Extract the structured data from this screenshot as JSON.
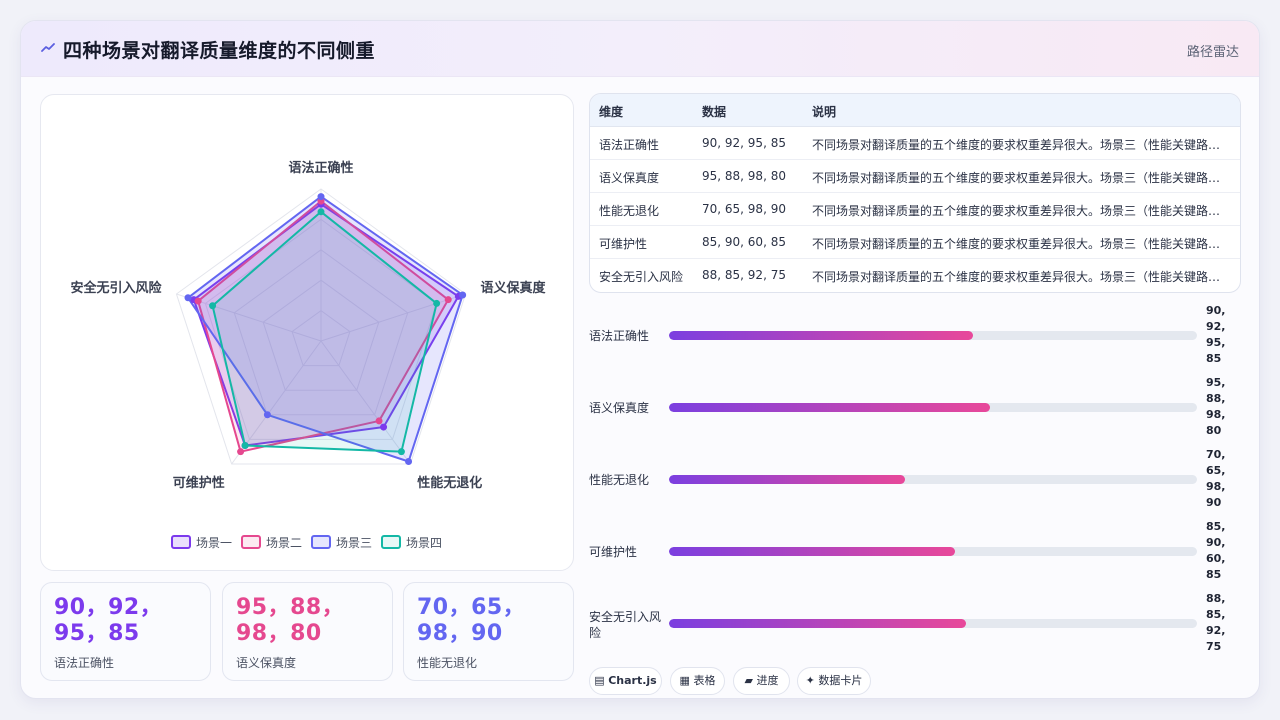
{
  "header": {
    "title": "四种场景对翻译质量维度的不同侧重",
    "tag": "路径雷达"
  },
  "colors": {
    "scenario1": "#7c3aed",
    "scenario2": "#e5488f",
    "scenario3": "#6366f1",
    "scenario4": "#14b8a6"
  },
  "chart_data": {
    "type": "radar",
    "categories": [
      "语法正确性",
      "语义保真度",
      "性能无退化",
      "可维护性",
      "安全无引入风险"
    ],
    "series": [
      {
        "name": "场景一",
        "values": [
          90,
          95,
          70,
          85,
          88
        ]
      },
      {
        "name": "场景二",
        "values": [
          92,
          88,
          65,
          90,
          85
        ]
      },
      {
        "name": "场景三",
        "values": [
          95,
          98,
          98,
          60,
          92
        ]
      },
      {
        "name": "场景四",
        "values": [
          85,
          80,
          90,
          85,
          75
        ]
      }
    ],
    "rlim": [
      0,
      100
    ],
    "legend_position": "bottom"
  },
  "table": {
    "headers": [
      "维度",
      "数据",
      "说明"
    ],
    "rows": [
      {
        "dimension": "语法正确性",
        "data": "90, 92, 95, 85",
        "note": "不同场景对翻译质量的五个维度的要求权重差异很大。场景三（性能关键路径…"
      },
      {
        "dimension": "语义保真度",
        "data": "95, 88, 98, 80",
        "note": "不同场景对翻译质量的五个维度的要求权重差异很大。场景三（性能关键路径…"
      },
      {
        "dimension": "性能无退化",
        "data": "70, 65, 98, 90",
        "note": "不同场景对翻译质量的五个维度的要求权重差异很大。场景三（性能关键路径…"
      },
      {
        "dimension": "可维护性",
        "data": "85, 90, 60, 85",
        "note": "不同场景对翻译质量的五个维度的要求权重差异很大。场景三（性能关键路径…"
      },
      {
        "dimension": "安全无引入风险",
        "data": "88, 85, 92, 75",
        "note": "不同场景对翻译质量的五个维度的要求权重差异很大。场景三（性能关键路径…"
      }
    ]
  },
  "progress": [
    {
      "label": "语法正确性",
      "value_lines": [
        "90,",
        "92,",
        "95,",
        "85"
      ],
      "fraction": 0.575
    },
    {
      "label": "语义保真度",
      "value_lines": [
        "95,",
        "88,",
        "98,",
        "80"
      ],
      "fraction": 0.608
    },
    {
      "label": "性能无退化",
      "value_lines": [
        "70,",
        "65,",
        "98,",
        "90"
      ],
      "fraction": 0.447
    },
    {
      "label": "可维护性",
      "value_lines": [
        "85,",
        "90,",
        "60,",
        "85"
      ],
      "fraction": 0.542
    },
    {
      "label": "安全无引入风险",
      "value_lines": [
        "88,",
        "85,",
        "92,",
        "75"
      ],
      "fraction": 0.562
    }
  ],
  "stat_cards": [
    {
      "value": "90，92，95，85",
      "label": "语法正确性"
    },
    {
      "value": "95，88，98，80",
      "label": "语义保真度"
    },
    {
      "value": "70，65，98，90",
      "label": "性能无退化"
    }
  ],
  "chips": [
    {
      "icon": "chart-icon",
      "label": "Chart.js"
    },
    {
      "icon": "table-icon",
      "label": "表格"
    },
    {
      "icon": "progress-icon",
      "label": "进度"
    },
    {
      "icon": "card-icon",
      "label": "数据卡片"
    }
  ]
}
